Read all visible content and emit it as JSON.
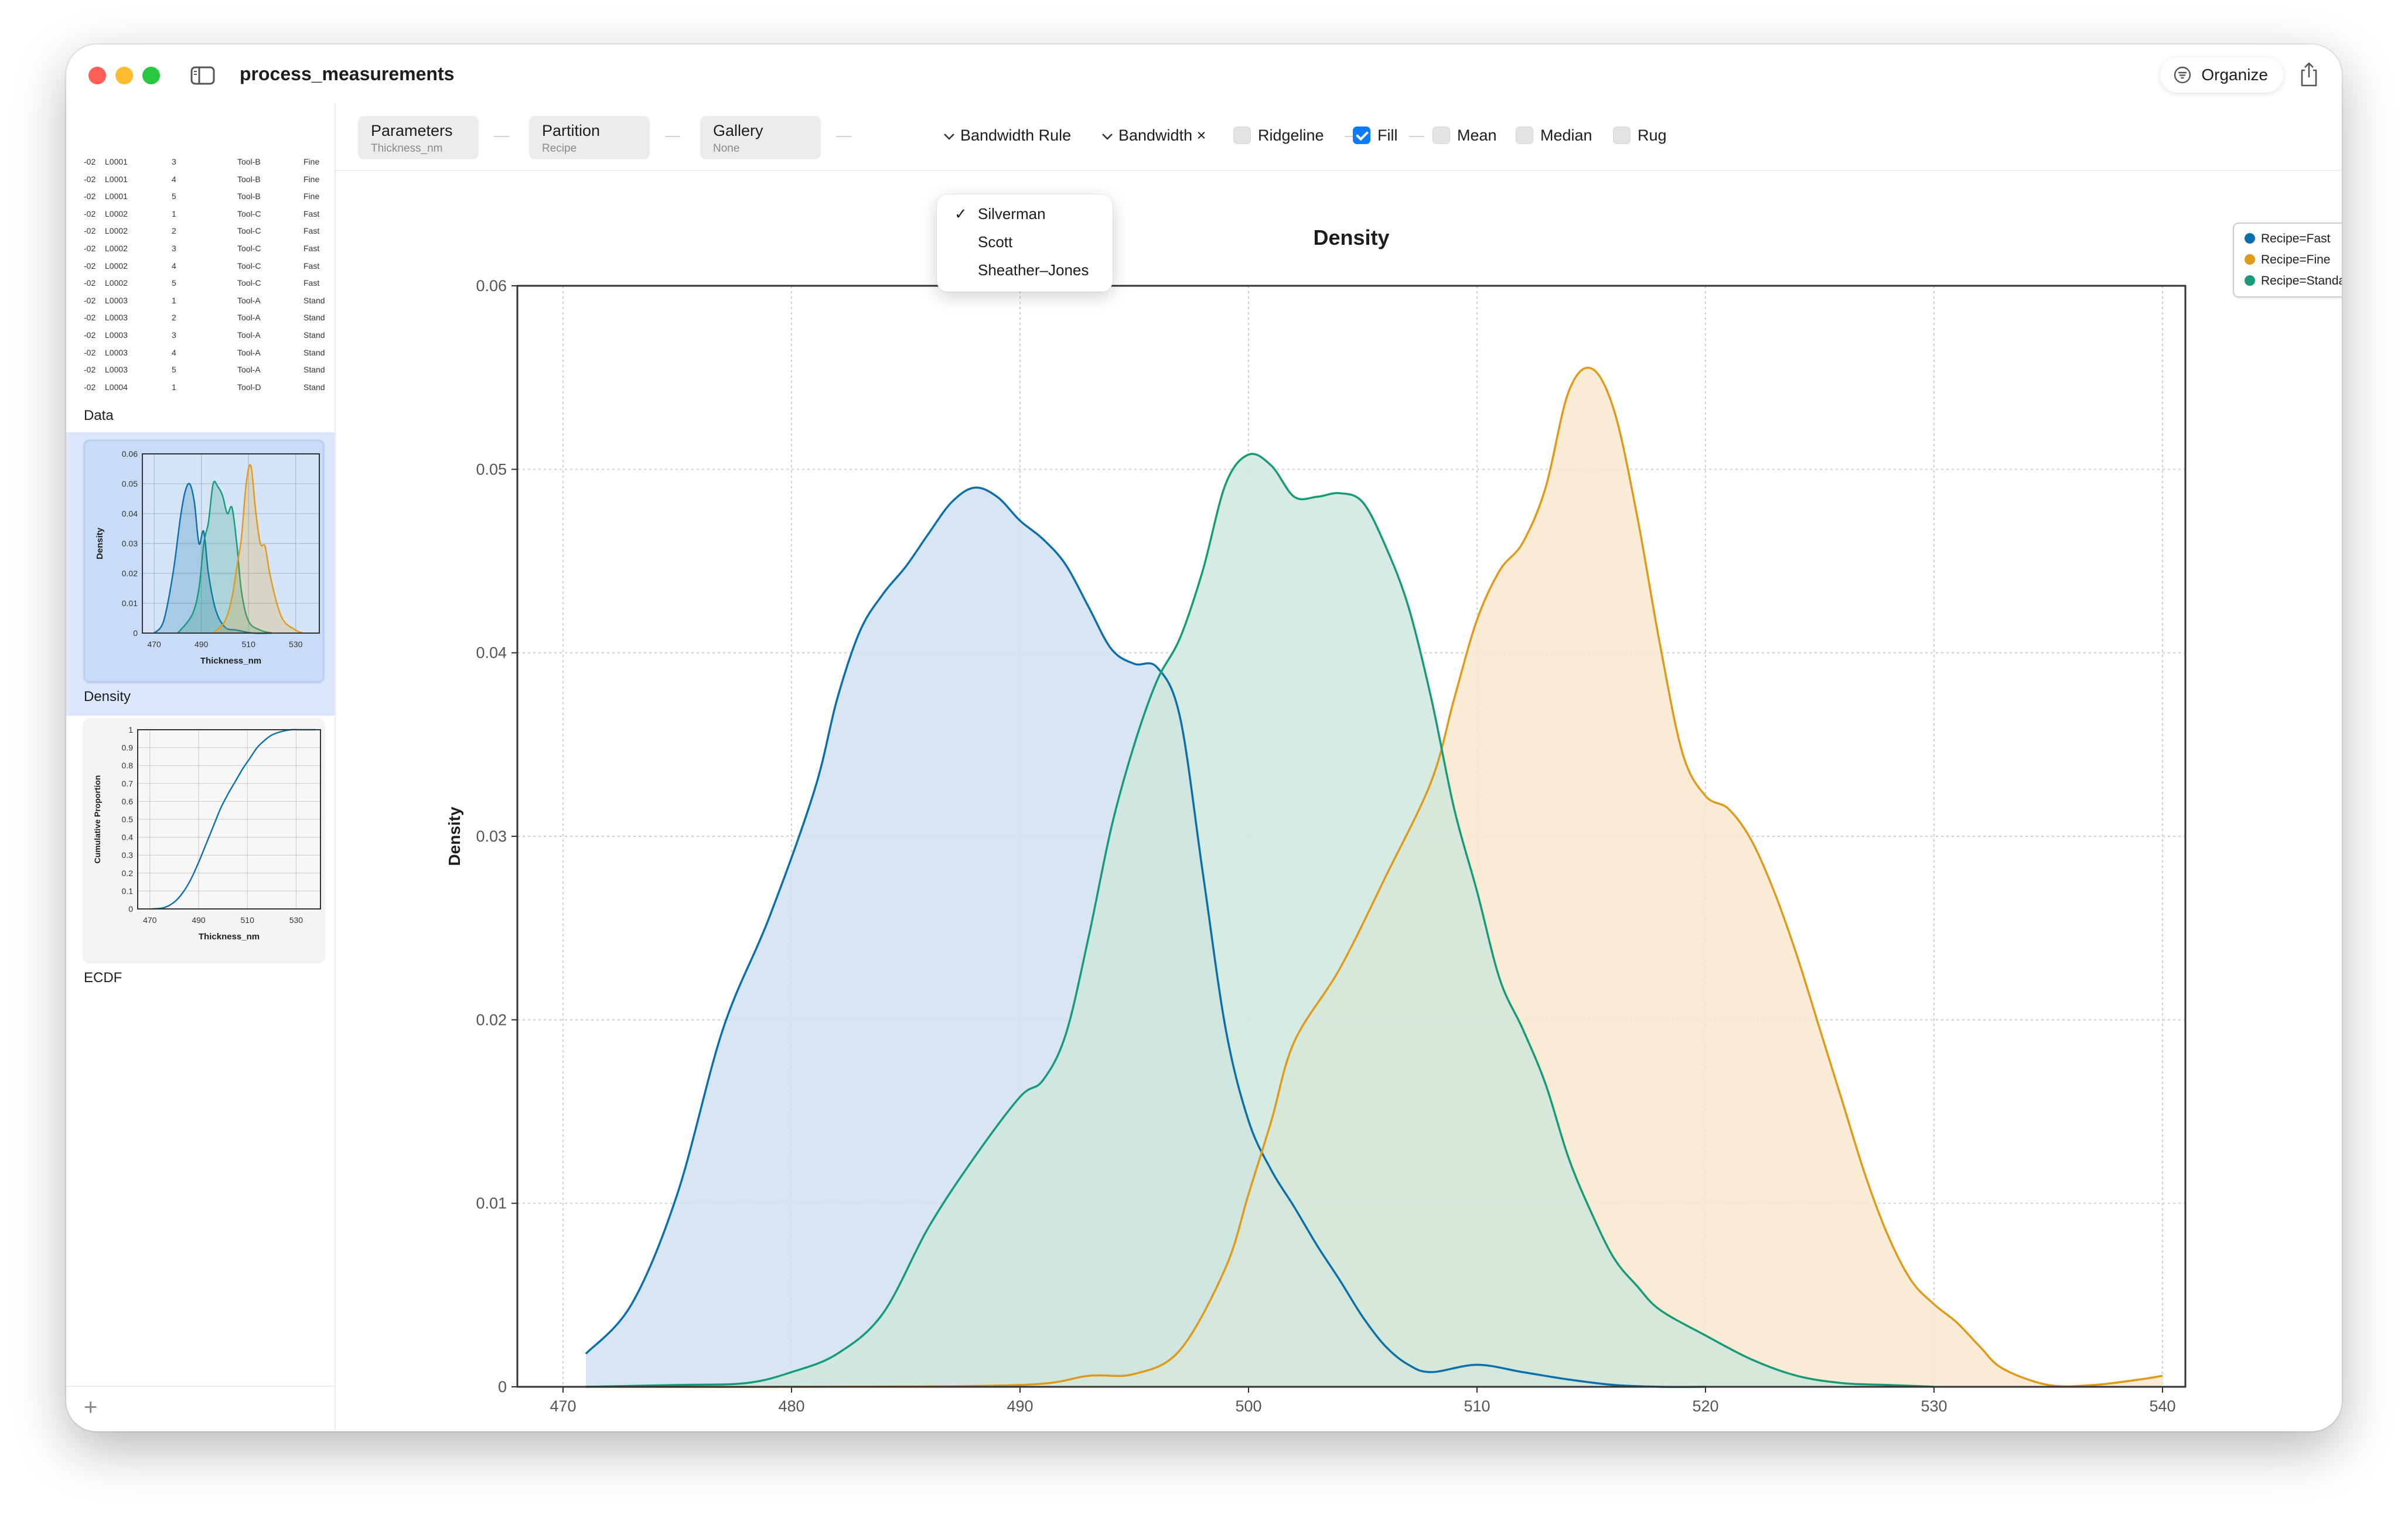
{
  "window": {
    "title": "process_measurements",
    "organize_label": "Organize"
  },
  "sidebar": {
    "data_rows": [
      [
        "-02",
        "L0001",
        "3",
        "Tool-B",
        "Fine"
      ],
      [
        "-02",
        "L0001",
        "4",
        "Tool-B",
        "Fine"
      ],
      [
        "-02",
        "L0001",
        "5",
        "Tool-B",
        "Fine"
      ],
      [
        "-02",
        "L0002",
        "1",
        "Tool-C",
        "Fast"
      ],
      [
        "-02",
        "L0002",
        "2",
        "Tool-C",
        "Fast"
      ],
      [
        "-02",
        "L0002",
        "3",
        "Tool-C",
        "Fast"
      ],
      [
        "-02",
        "L0002",
        "4",
        "Tool-C",
        "Fast"
      ],
      [
        "-02",
        "L0002",
        "5",
        "Tool-C",
        "Fast"
      ],
      [
        "-02",
        "L0003",
        "1",
        "Tool-A",
        "Stand"
      ],
      [
        "-02",
        "L0003",
        "2",
        "Tool-A",
        "Stand"
      ],
      [
        "-02",
        "L0003",
        "3",
        "Tool-A",
        "Stand"
      ],
      [
        "-02",
        "L0003",
        "4",
        "Tool-A",
        "Stand"
      ],
      [
        "-02",
        "L0003",
        "5",
        "Tool-A",
        "Stand"
      ],
      [
        "-02",
        "L0004",
        "1",
        "Tool-D",
        "Stand"
      ]
    ],
    "items": [
      {
        "label": "Data"
      },
      {
        "label": "Density"
      },
      {
        "label": "ECDF"
      }
    ],
    "add_label": "+",
    "density_thumb": {
      "ylabel": "Density",
      "xlabel": "Thickness_nm",
      "yticks": [
        "0.06",
        "0.05",
        "0.04",
        "0.03",
        "0.02",
        "0.01",
        "0"
      ],
      "xticks": [
        "470",
        "490",
        "510",
        "530"
      ]
    },
    "ecdf_thumb": {
      "ylabel": "Cumulative Proportion",
      "xlabel": "Thickness_nm",
      "yticks": [
        "1",
        "0.9",
        "0.8",
        "0.7",
        "0.6",
        "0.5",
        "0.4",
        "0.3",
        "0.2",
        "0.1",
        "0"
      ],
      "xticks": [
        "470",
        "490",
        "510",
        "530"
      ]
    }
  },
  "toolbar": {
    "pills": [
      {
        "title": "Parameters",
        "sub": "Thickness_nm"
      },
      {
        "title": "Partition",
        "sub": "Recipe"
      },
      {
        "title": "Gallery",
        "sub": "None"
      }
    ],
    "bandwidth_rule_label": "Bandwidth Rule",
    "bandwidth_label": "Bandwidth ×",
    "checkboxes": [
      {
        "label": "Ridgeline",
        "checked": false
      },
      {
        "label": "Fill",
        "checked": true
      },
      {
        "label": "Mean",
        "checked": false
      },
      {
        "label": "Median",
        "checked": false
      },
      {
        "label": "Rug",
        "checked": false
      }
    ]
  },
  "bandwidth_menu": {
    "options": [
      "Silverman",
      "Scott",
      "Sheather–Jones"
    ],
    "selected": "Silverman",
    "check_glyph": "✓"
  },
  "colors": {
    "fast": "#0a6faa",
    "fine": "#e09a1a",
    "standard": "#169a78",
    "accent": "#0a7aff"
  },
  "chart_data": {
    "type": "area",
    "title": "Density",
    "xlabel": "Thickness_nm",
    "ylabel": "Density",
    "xlim": [
      468,
      541
    ],
    "ylim": [
      0,
      0.06
    ],
    "xticks": [
      470,
      480,
      490,
      500,
      510,
      520,
      530,
      540
    ],
    "yticks": [
      0,
      0.01,
      0.02,
      0.03,
      0.04,
      0.05,
      0.06
    ],
    "grid": true,
    "legend_position": "top-right",
    "series": [
      {
        "name": "Recipe=Fast",
        "color": "#0a6faa",
        "fill": "#cfe0f0",
        "x": [
          471,
          473,
          475,
          477,
          479,
          481,
          482,
          483,
          484,
          485,
          486,
          487,
          488,
          489,
          490,
          491,
          492,
          493,
          494,
          495,
          496,
          497,
          498,
          499,
          500,
          501,
          502,
          503,
          504,
          505,
          506,
          507,
          508,
          510,
          512,
          514,
          516,
          518,
          520
        ],
        "y": [
          0.0018,
          0.0045,
          0.0105,
          0.0195,
          0.0255,
          0.0325,
          0.0375,
          0.0412,
          0.0432,
          0.0447,
          0.0465,
          0.0482,
          0.049,
          0.0485,
          0.0472,
          0.0462,
          0.0448,
          0.0425,
          0.0402,
          0.0394,
          0.0392,
          0.0365,
          0.028,
          0.0195,
          0.0145,
          0.0118,
          0.0098,
          0.0077,
          0.0058,
          0.0038,
          0.0022,
          0.0012,
          0.0008,
          0.0012,
          0.0008,
          0.0004,
          0.0001,
          0.0,
          0.0
        ]
      },
      {
        "name": "Recipe=Fine",
        "color": "#e09a1a",
        "fill": "#f8e6cb",
        "x": [
          471,
          480,
          490,
          493,
          495,
          497,
          499,
          500,
          501,
          502,
          504,
          506,
          508,
          509,
          510,
          511,
          512,
          513,
          514,
          515,
          516,
          517,
          518,
          519,
          520,
          521,
          522,
          523,
          524,
          525,
          526,
          527,
          528,
          529,
          530,
          531,
          532,
          533,
          535,
          537,
          539,
          540
        ],
        "y": [
          0.0,
          0.0,
          0.0001,
          0.0006,
          0.0007,
          0.002,
          0.0065,
          0.0105,
          0.0145,
          0.0188,
          0.0228,
          0.0278,
          0.033,
          0.0375,
          0.0418,
          0.0445,
          0.046,
          0.049,
          0.0542,
          0.0555,
          0.0532,
          0.0475,
          0.0405,
          0.0345,
          0.0322,
          0.0315,
          0.0298,
          0.027,
          0.0235,
          0.0195,
          0.0155,
          0.0115,
          0.0082,
          0.0058,
          0.0045,
          0.0035,
          0.0022,
          0.001,
          0.0001,
          0.0001,
          0.0004,
          0.0006
        ]
      },
      {
        "name": "Recipe=Standard",
        "color": "#169a78",
        "fill": "#cde6dc",
        "x": [
          471,
          475,
          478,
          480,
          482,
          484,
          486,
          488,
          490,
          491,
          492,
          493,
          494,
          495,
          496,
          497,
          498,
          499,
          500,
          501,
          502,
          503,
          504,
          505,
          506,
          507,
          508,
          509,
          510,
          511,
          512,
          513,
          514,
          515,
          516,
          517,
          518,
          520,
          522,
          524,
          526,
          528,
          530
        ],
        "y": [
          0.0,
          0.0001,
          0.0002,
          0.0008,
          0.0018,
          0.004,
          0.0087,
          0.0125,
          0.0158,
          0.0167,
          0.0192,
          0.0245,
          0.0305,
          0.035,
          0.0385,
          0.0408,
          0.0445,
          0.0492,
          0.0508,
          0.0502,
          0.0485,
          0.0485,
          0.0487,
          0.0482,
          0.0458,
          0.0425,
          0.0375,
          0.0315,
          0.027,
          0.0222,
          0.0195,
          0.0165,
          0.0125,
          0.0095,
          0.007,
          0.0055,
          0.0042,
          0.0028,
          0.0015,
          0.0006,
          0.0002,
          0.0001,
          0.0
        ]
      }
    ]
  }
}
